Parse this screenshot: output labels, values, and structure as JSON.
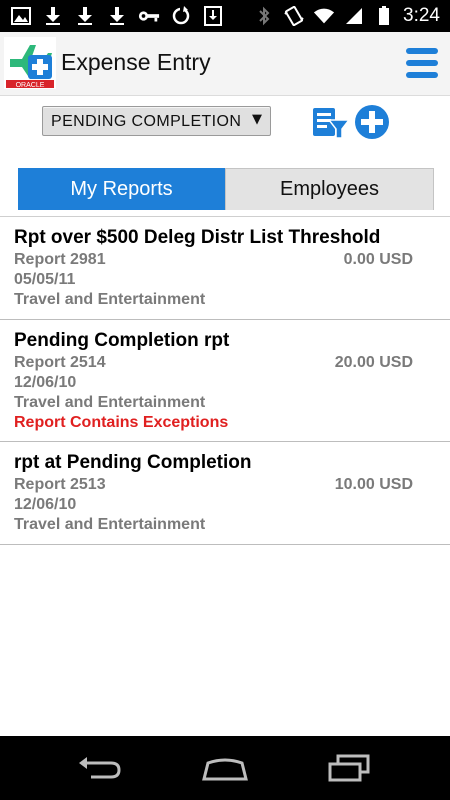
{
  "status_bar": {
    "time": "3:24",
    "left_icons": [
      "image-icon",
      "download-icon",
      "download-icon",
      "download-icon",
      "key-icon",
      "sync-icon",
      "download-box-icon"
    ],
    "right_icons": [
      "bluetooth-icon",
      "vibrate-icon",
      "wifi-icon",
      "signal-icon",
      "battery-icon"
    ]
  },
  "header": {
    "title": "Expense Entry",
    "logo_text": "ORACLE",
    "menu_icon": "hamburger-menu-icon"
  },
  "filter": {
    "selected_status": "PENDING COMPLETION",
    "filter_icon": "filter-list-icon",
    "add_icon": "add-circle-icon"
  },
  "tabs": [
    {
      "label": "My Reports",
      "active": true
    },
    {
      "label": "Employees",
      "active": false
    }
  ],
  "reports": [
    {
      "title": "Rpt over $500 Deleg Distr List Threshold",
      "report_number": "Report 2981",
      "amount": "0.00 USD",
      "date": "05/05/11",
      "category": "Travel and Entertainment",
      "exception": ""
    },
    {
      "title": "Pending Completion rpt",
      "report_number": "Report 2514",
      "amount": "20.00 USD",
      "date": "12/06/10",
      "category": "Travel and Entertainment",
      "exception": "Report Contains Exceptions"
    },
    {
      "title": "rpt at Pending Completion",
      "report_number": "Report 2513",
      "amount": "10.00 USD",
      "date": "12/06/10",
      "category": "Travel and Entertainment",
      "exception": ""
    }
  ],
  "colors": {
    "accent": "#1e7fd8",
    "exception": "#e02020",
    "secondary_text": "#7a7a7a",
    "logo_green": "#2db87a",
    "logo_red": "#d8242a"
  },
  "nav": {
    "back_icon": "back-icon",
    "home_icon": "home-icon",
    "recents_icon": "recents-icon"
  }
}
